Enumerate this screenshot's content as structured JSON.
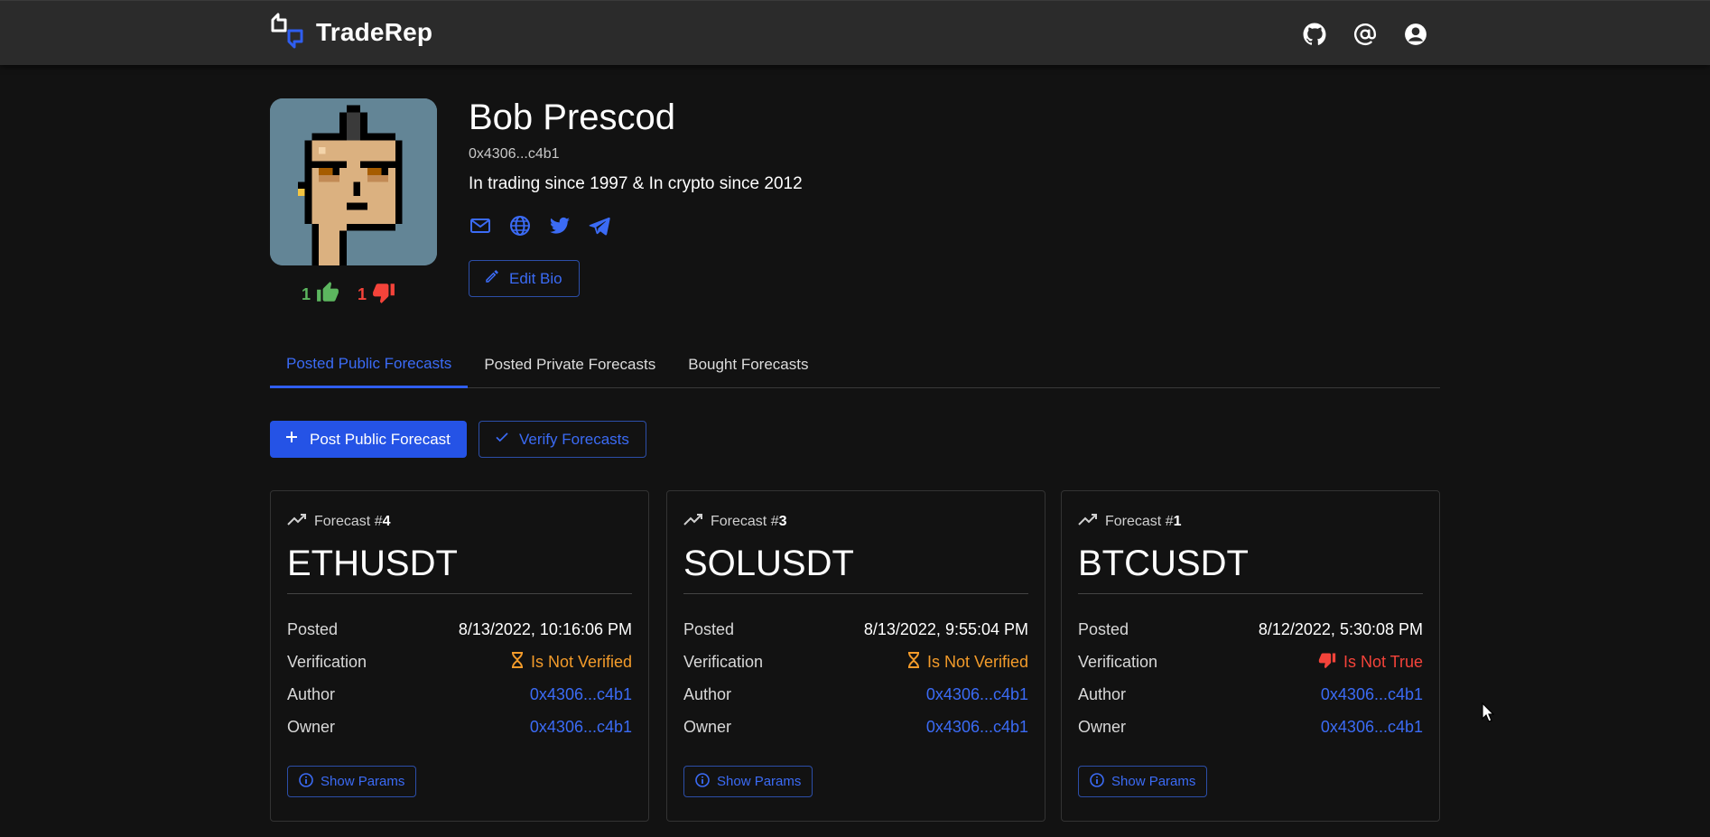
{
  "app": {
    "brand": "TradeRep"
  },
  "header": {
    "actions": [
      "github-icon",
      "at-sign-icon",
      "account-circle-icon"
    ]
  },
  "profile": {
    "name": "Bob Prescod",
    "address": "0x4306...c4b1",
    "bio": "In trading since 1997 & In crypto since 2012",
    "likes": "1",
    "dislikes": "1",
    "social": [
      "mail-icon",
      "globe-icon",
      "twitter-icon",
      "telegram-icon"
    ],
    "edit_bio_label": "Edit Bio"
  },
  "tabs": [
    {
      "label": "Posted Public Forecasts",
      "active": true
    },
    {
      "label": "Posted Private Forecasts",
      "active": false
    },
    {
      "label": "Bought Forecasts",
      "active": false
    }
  ],
  "actions": {
    "post_label": "Post Public Forecast",
    "verify_label": "Verify Forecasts"
  },
  "labels": {
    "forecast_prefix": "Forecast #",
    "posted": "Posted",
    "verification": "Verification",
    "author": "Author",
    "owner": "Owner",
    "show_params": "Show Params"
  },
  "forecasts": [
    {
      "number": "4",
      "symbol": "ETHUSDT",
      "posted": "8/13/2022, 10:16:06 PM",
      "verification": "Is Not Verified",
      "verification_state": "pending",
      "author": "0x4306...c4b1",
      "owner": "0x4306...c4b1"
    },
    {
      "number": "3",
      "symbol": "SOLUSDT",
      "posted": "8/13/2022, 9:55:04 PM",
      "verification": "Is Not Verified",
      "verification_state": "pending",
      "author": "0x4306...c4b1",
      "owner": "0x4306...c4b1"
    },
    {
      "number": "1",
      "symbol": "BTCUSDT",
      "posted": "8/12/2022, 5:30:08 PM",
      "verification": "Is Not True",
      "verification_state": "false",
      "author": "0x4306...c4b1",
      "owner": "0x4306...c4b1"
    }
  ],
  "colors": {
    "accent": "#2553e6",
    "link": "#3b6bf5",
    "warning": "#f39b2a",
    "error": "#f4433a",
    "success": "#5cb65f",
    "appbar": "#2b2b2b",
    "background": "#121212"
  }
}
